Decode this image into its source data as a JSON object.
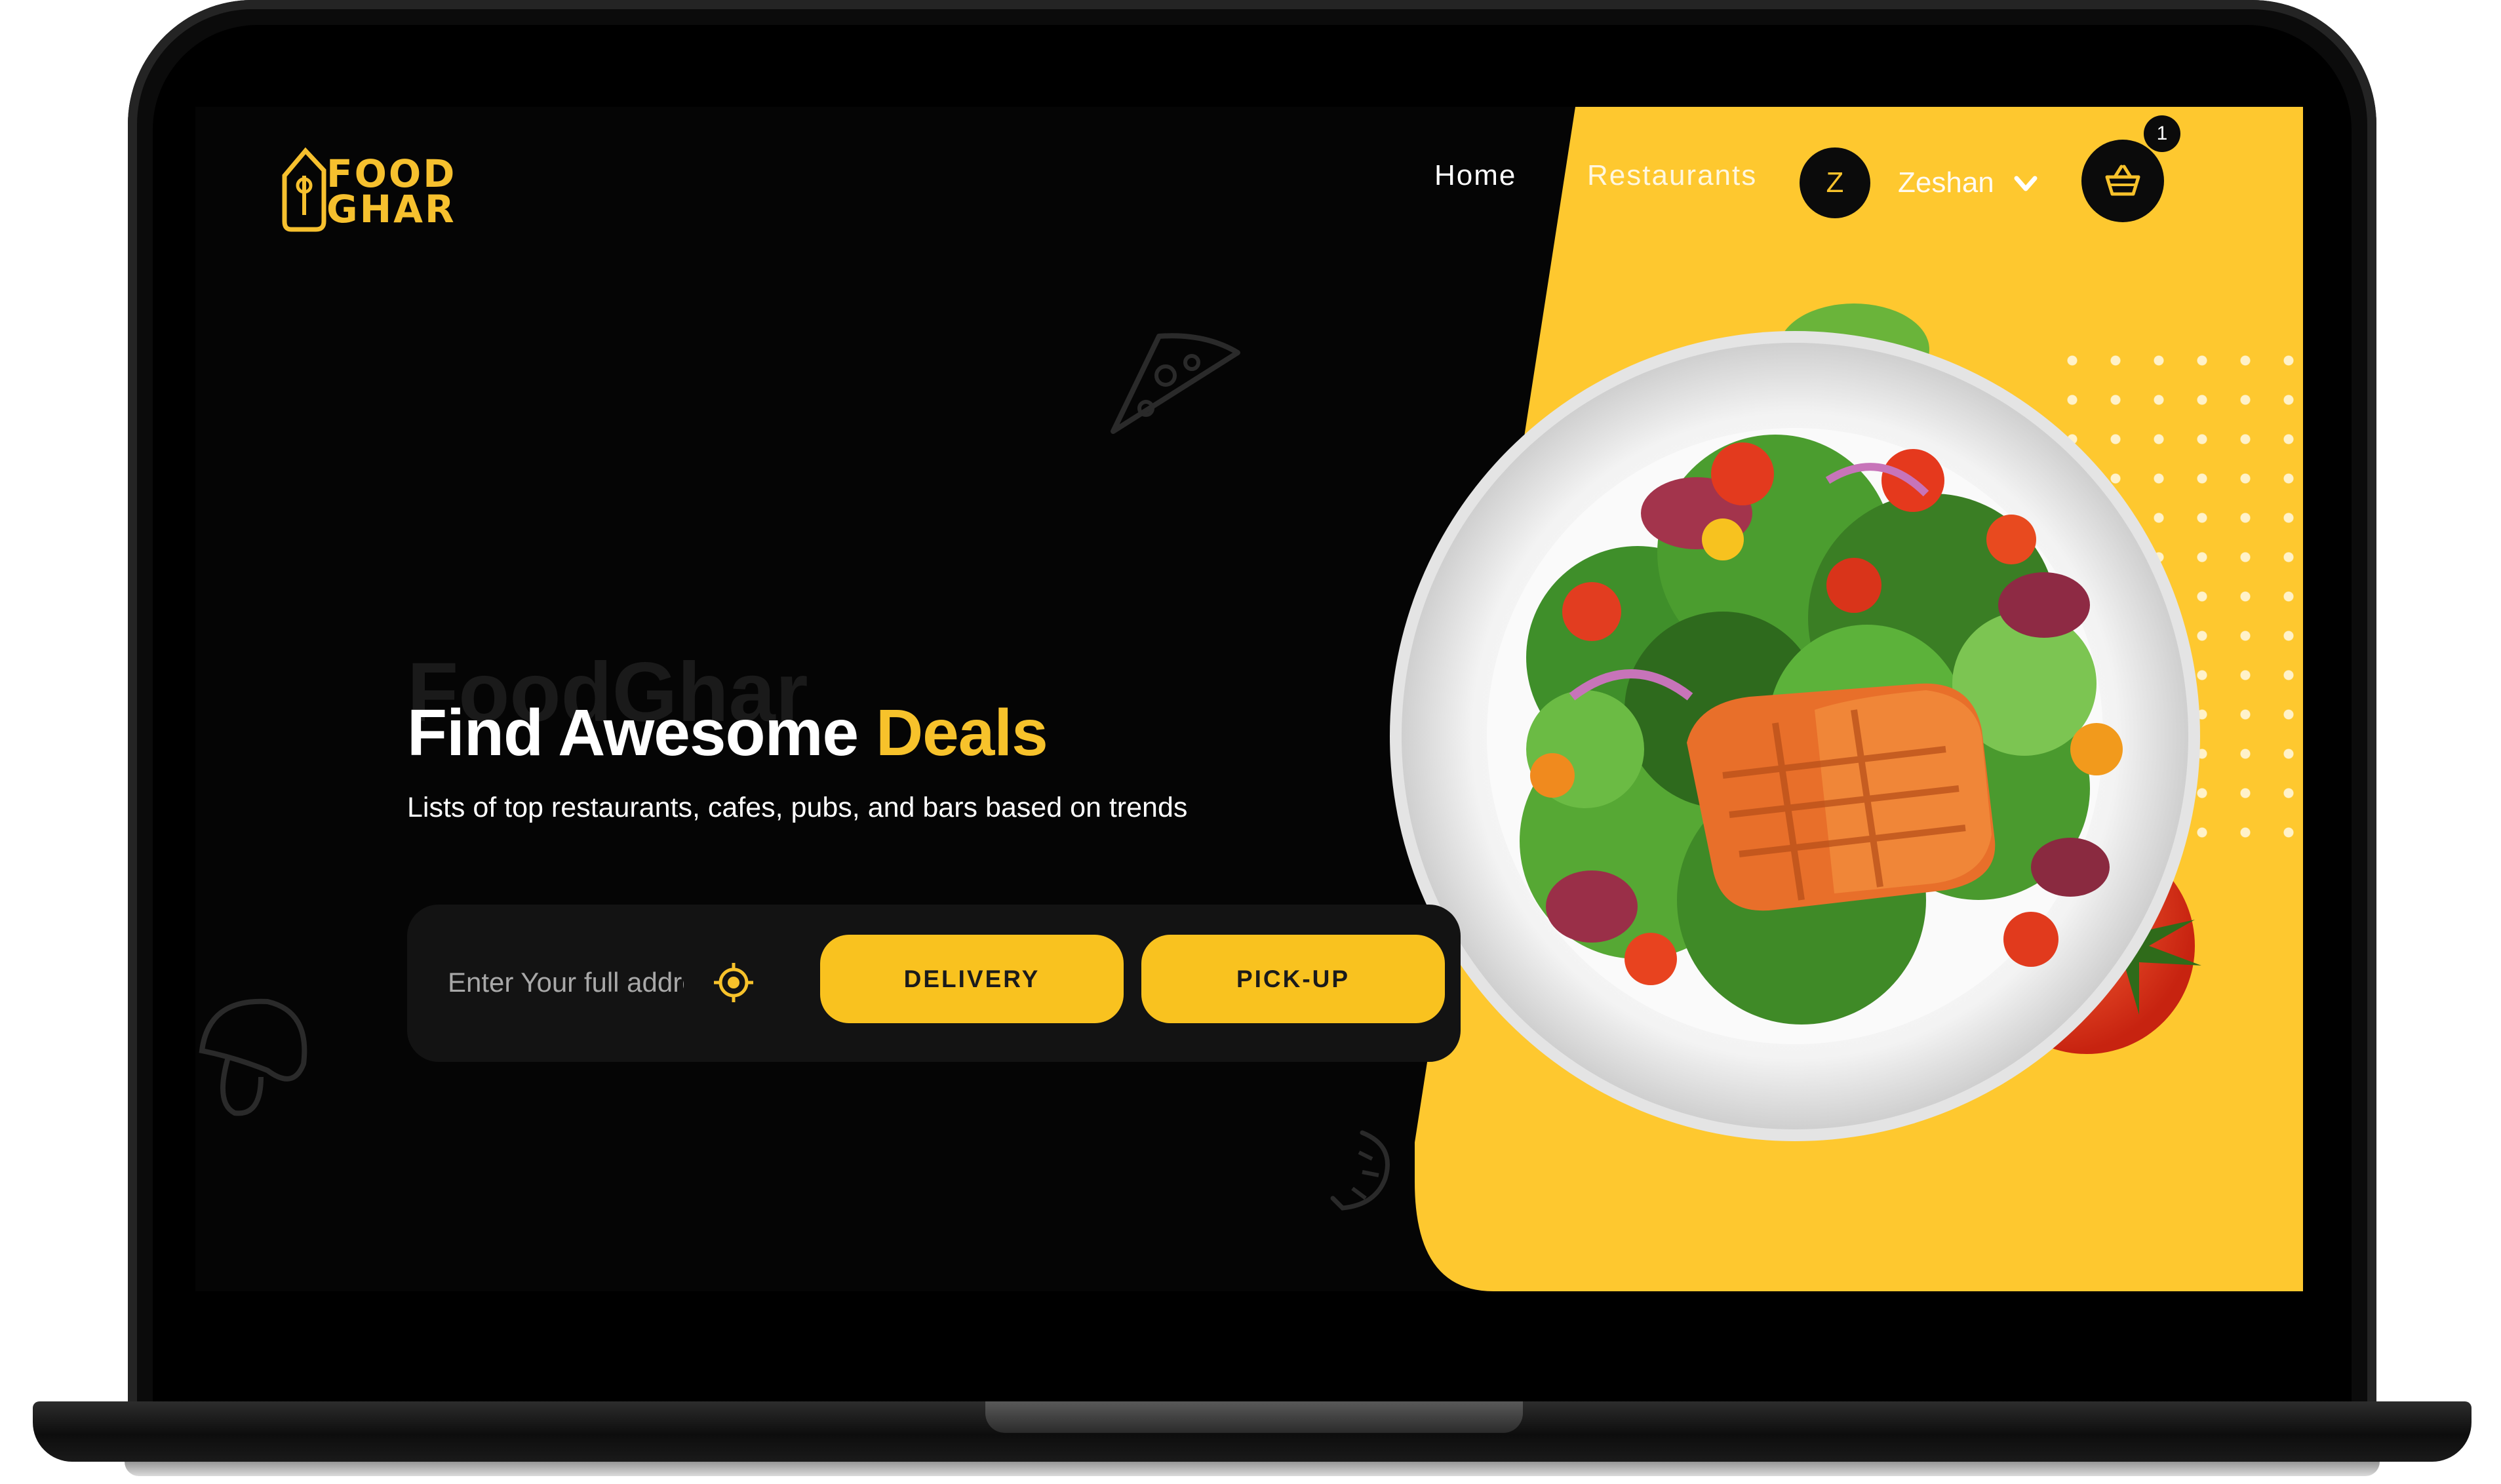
{
  "brand": {
    "logo_line1": "FOOD",
    "logo_line2": "GHAR"
  },
  "nav": {
    "home": "Home",
    "restaurants": "Restaurants"
  },
  "user": {
    "initial": "Z",
    "name": "Zeshan"
  },
  "cart": {
    "count": "1"
  },
  "hero": {
    "background_word": "FoodGhar",
    "title_part1": "Find Awesome ",
    "title_highlight": "Deals",
    "subtitle": "Lists of top restaurants, cafes, pubs, and bars based on trends"
  },
  "search": {
    "address_placeholder": "Enter Your full address",
    "address_value": "",
    "delivery_label": "DELIVERY",
    "pickup_label": "PICK-UP"
  },
  "icons": {
    "locate": "crosshair-location-icon",
    "cart": "basket-icon",
    "chevron": "chevron-down-icon",
    "doodles": [
      "pizza-slice-icon",
      "mushroom-icon",
      "shrimp-icon"
    ]
  },
  "colors": {
    "accent": "#f7c22b",
    "background": "#050505",
    "button_text": "#1b1b1b"
  }
}
